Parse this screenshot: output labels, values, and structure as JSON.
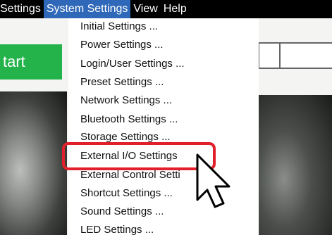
{
  "menubar": {
    "items": [
      "Settings",
      "System Settings",
      "View",
      "Help"
    ]
  },
  "system_settings_menu": {
    "items": [
      "Initial Settings ...",
      "Power Settings ...",
      "Login/User Settings ...",
      "Preset Settings ...",
      "Network Settings ...",
      "Bluetooth Settings ...",
      "Storage Settings ...",
      "External I/O Settings",
      "External Control Setti",
      "Shortcut Settings ...",
      "Sound Settings ...",
      "LED Settings ..."
    ],
    "highlighted_item": "External I/O Settings"
  },
  "start_button": {
    "label": "tart"
  },
  "colors": {
    "menubar_bg": "#000000",
    "menubar_active": "#2f68b8",
    "start_button": "#23b34a",
    "highlight_ring": "#e2202b"
  },
  "icons": {
    "cursor": "arrow-pointer-icon"
  }
}
